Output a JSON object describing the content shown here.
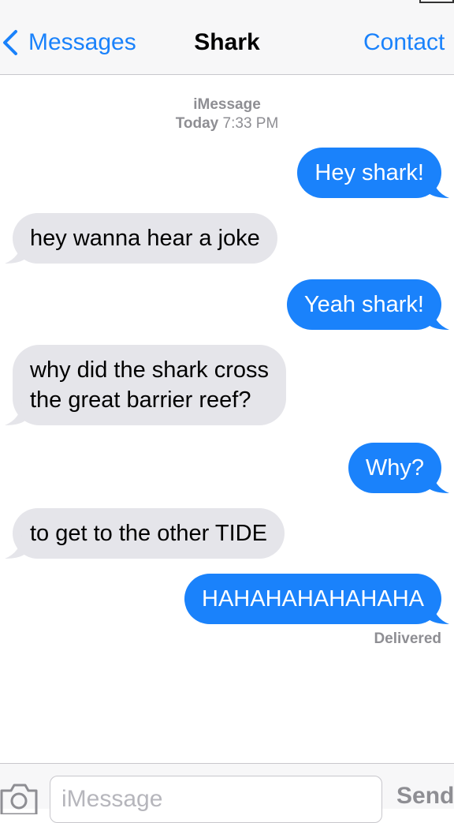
{
  "nav": {
    "back_label": "Messages",
    "title": "Shark",
    "right_label": "Contact"
  },
  "thread": {
    "service": "iMessage",
    "day": "Today",
    "time": "7:33 PM"
  },
  "messages": [
    {
      "from": "me",
      "text": "Hey shark!"
    },
    {
      "from": "them",
      "text": "hey wanna hear a joke"
    },
    {
      "from": "me",
      "text": "Yeah shark!"
    },
    {
      "from": "them",
      "lines": [
        "why did the shark cross",
        "the great barrier reef?"
      ]
    },
    {
      "from": "me",
      "text": "Why?"
    },
    {
      "from": "them",
      "text": "to get to the other TIDE"
    },
    {
      "from": "me",
      "text": "HAHAHAHAHAHAHA"
    }
  ],
  "status": "Delivered",
  "composer": {
    "placeholder": "iMessage",
    "send_label": "Send",
    "camera_icon": "camera-icon"
  },
  "colors": {
    "outgoing_bubble": "#1a82fb",
    "incoming_bubble": "#e5e5ea",
    "accent": "#1a82fb",
    "meta_text": "#8e8e93"
  }
}
